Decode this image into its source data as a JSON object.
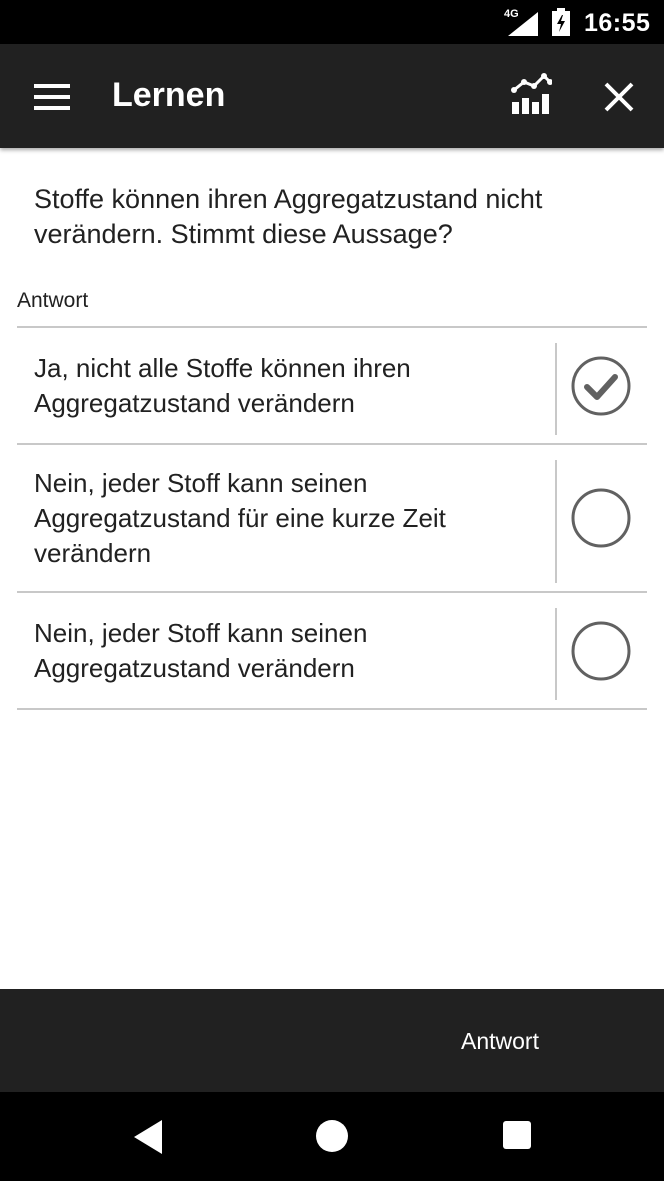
{
  "status_bar": {
    "network": "4G",
    "time": "16:55"
  },
  "app_bar": {
    "title": "Lernen",
    "icons": [
      "menu-icon",
      "statistics-icon",
      "close-icon"
    ]
  },
  "question": {
    "text": "Stoffe können ihren Aggregatzustand nicht verändern. Stimmt diese Aussage?"
  },
  "answer_section": {
    "label": "Antwort",
    "options": [
      {
        "line1": "Ja, nicht alle Stoffe können ihren",
        "line2": "Aggregatzustand verändern",
        "line3": "",
        "selected": true
      },
      {
        "line1": "Nein, jeder Stoff kann seinen",
        "line2": "Aggregatzustand für eine kurze Zeit",
        "line3": "verändern",
        "selected": false
      },
      {
        "line1": "Nein, jeder Stoff kann seinen",
        "line2": "Aggregatzustand verändern",
        "line3": "",
        "selected": false
      }
    ]
  },
  "bottom_bar": {
    "answer_button_label": "Antwort"
  },
  "colors": {
    "app_bar": "#212121",
    "status_bar": "#000000",
    "divider": "#c8c8c8",
    "check_icon": "#616161"
  }
}
